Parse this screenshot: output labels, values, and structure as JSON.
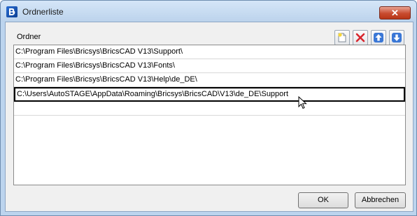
{
  "window": {
    "title": "Ordnerliste",
    "close_glyph": "✕"
  },
  "list": {
    "header": "Ordner",
    "rows": [
      "C:\\Program Files\\Bricsys\\BricsCAD V13\\Support\\",
      "C:\\Program Files\\Bricsys\\BricsCAD V13\\Fonts\\",
      "C:\\Program Files\\Bricsys\\BricsCAD V13\\Help\\de_DE\\",
      "C:\\Users\\AutoSTAGE\\AppData\\Roaming\\Bricsys\\BricsCAD\\V13\\de_DE\\Support"
    ],
    "selected_index": 3
  },
  "toolbar": {
    "icons": [
      "new-folder-icon",
      "delete-icon",
      "move-up-icon",
      "move-down-icon"
    ]
  },
  "buttons": {
    "ok": "OK",
    "cancel": "Abbrechen"
  },
  "colors": {
    "accent": "#2b6dd1",
    "delete": "#d8262e"
  }
}
